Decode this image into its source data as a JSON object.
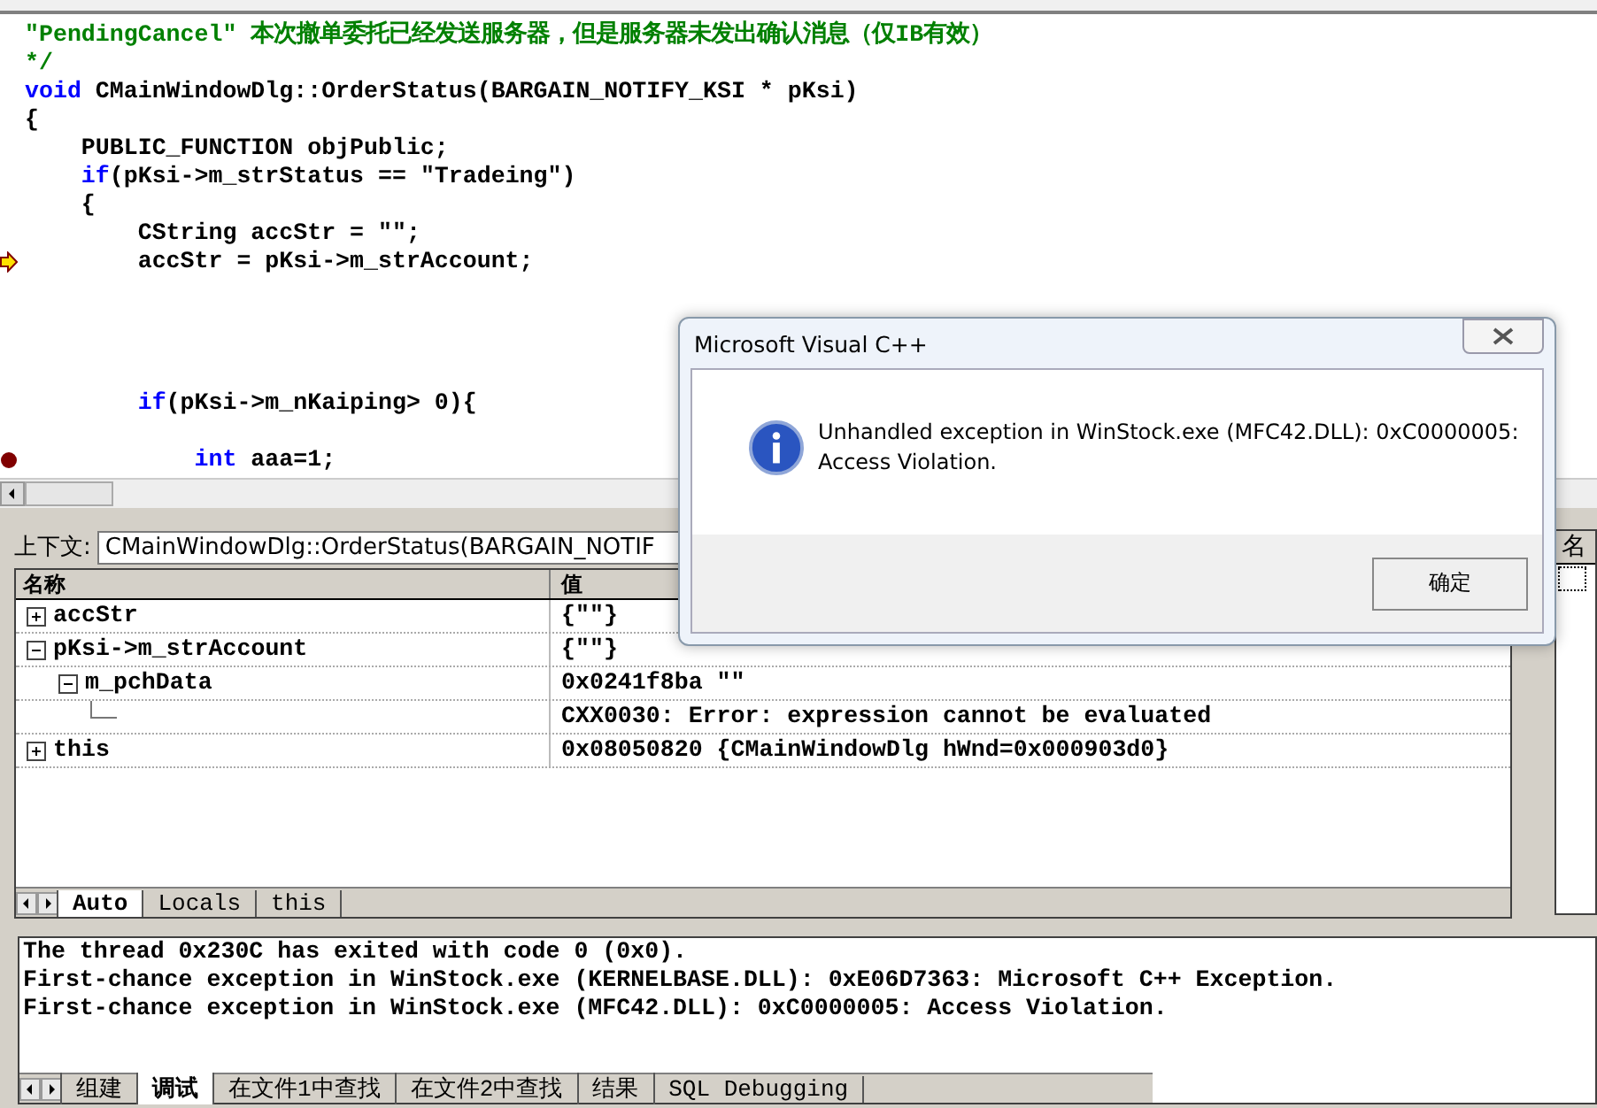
{
  "editor": {
    "lines": [
      {
        "kind": "code",
        "segments": [
          {
            "kind": "comment",
            "text": "\"PendingCancel\" 本次撤单委托已经发送服务器，但是服务器未发出确认消息（仅IB有效）"
          }
        ],
        "current": false,
        "breakpoint": false
      },
      {
        "kind": "code",
        "segments": [
          {
            "kind": "comment",
            "text": "*/"
          }
        ],
        "current": false,
        "breakpoint": false
      },
      {
        "kind": "code",
        "segments": [
          {
            "kind": "keyword",
            "text": "void"
          },
          {
            "kind": "plain",
            "text": " CMainWindowDlg::OrderStatus(BARGAIN_NOTIFY_KSI * pKsi)"
          }
        ],
        "current": false,
        "breakpoint": false
      },
      {
        "kind": "code",
        "segments": [
          {
            "kind": "plain",
            "text": "{"
          }
        ],
        "current": false,
        "breakpoint": false
      },
      {
        "kind": "code",
        "segments": [
          {
            "kind": "plain",
            "text": "    PUBLIC_FUNCTION objPublic;"
          }
        ],
        "current": false,
        "breakpoint": false
      },
      {
        "kind": "code",
        "segments": [
          {
            "kind": "keyword",
            "text": "    if"
          },
          {
            "kind": "plain",
            "text": "(pKsi->m_strStatus == \"Tradeing\")"
          }
        ],
        "current": false,
        "breakpoint": false
      },
      {
        "kind": "code",
        "segments": [
          {
            "kind": "plain",
            "text": "    {"
          }
        ],
        "current": false,
        "breakpoint": false
      },
      {
        "kind": "code",
        "segments": [
          {
            "kind": "plain",
            "text": "        CString accStr = \"\";"
          }
        ],
        "current": false,
        "breakpoint": false
      },
      {
        "kind": "code",
        "segments": [
          {
            "kind": "plain",
            "text": "        accStr = pKsi->m_strAccount;"
          }
        ],
        "current": true,
        "breakpoint": false
      },
      {
        "kind": "blank",
        "current": false,
        "breakpoint": false
      },
      {
        "kind": "blank",
        "current": false,
        "breakpoint": false
      },
      {
        "kind": "blank",
        "current": false,
        "breakpoint": false
      },
      {
        "kind": "blank",
        "current": false,
        "breakpoint": false
      },
      {
        "kind": "code",
        "segments": [
          {
            "kind": "keyword",
            "text": "        if"
          },
          {
            "kind": "plain",
            "text": "(pKsi->m_nKaiping> 0){"
          }
        ],
        "current": false,
        "breakpoint": false
      },
      {
        "kind": "blank",
        "current": false,
        "breakpoint": false
      },
      {
        "kind": "code",
        "segments": [
          {
            "kind": "keyword",
            "text": "            int"
          },
          {
            "kind": "plain",
            "text": " aaa=1;"
          }
        ],
        "current": false,
        "breakpoint": true
      }
    ]
  },
  "variables": {
    "context_label": "上下文:",
    "context_value": "CMainWindowDlg::OrderStatus(BARGAIN_NOTIF",
    "columns": [
      "名称",
      "值"
    ],
    "rows": [
      {
        "name": "accStr",
        "value": "{\"\"}",
        "expanded": false
      },
      {
        "name": "pKsi->m_strAccount",
        "value": "{\"\"}",
        "expanded": true,
        "children": [
          {
            "name": "m_pchData",
            "value": "0x0241f8ba \"\"",
            "expanded": true,
            "children": [
              {
                "value": "CXX0030: Error: expression cannot be evaluated"
              }
            ]
          }
        ]
      },
      {
        "name": "this",
        "value": "0x08050820 {CMainWindowDlg hWnd=0x000903d0}",
        "expanded": false
      }
    ],
    "tabs": [
      {
        "label": "Auto",
        "selected": true
      },
      {
        "label": "Locals",
        "selected": false
      },
      {
        "label": "this",
        "selected": false
      }
    ]
  },
  "watch": {
    "column": "名"
  },
  "output": {
    "lines": [
      "The thread 0x230C has exited with code 0 (0x0).",
      "First-chance exception in WinStock.exe (KERNELBASE.DLL): 0xE06D7363: Microsoft C++ Exception.",
      "First-chance exception in WinStock.exe (MFC42.DLL): 0xC0000005: Access Violation."
    ],
    "tabs": [
      {
        "label": "组建",
        "selected": false
      },
      {
        "label": "调试",
        "selected": true
      },
      {
        "label": "在文件1中查找",
        "selected": false
      },
      {
        "label": "在文件2中查找",
        "selected": false
      },
      {
        "label": "结果",
        "selected": false
      },
      {
        "label": "SQL Debugging",
        "selected": false
      }
    ]
  },
  "dialog": {
    "title": "Microsoft Visual C++",
    "message": "Unhandled exception in WinStock.exe (MFC42.DLL): 0xC0000005: Access Violation.",
    "button": "确定"
  }
}
